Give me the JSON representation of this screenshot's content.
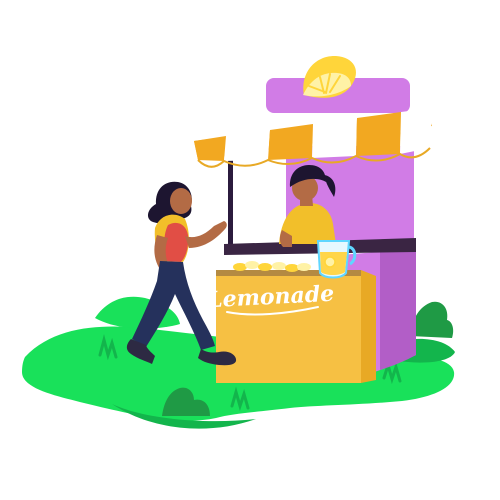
{
  "sign": {
    "text": "Lemonade"
  },
  "colors": {
    "grass": "#19e15a",
    "grass_dark": "#13b54c",
    "bush": "#1f9a45",
    "stall_purple": "#d17ce6",
    "stall_purple_dark": "#b25ec7",
    "stall_frame": "#2b1b3d",
    "awning_yellow": "#f2a821",
    "awning_white": "#ffffff",
    "counter_yellow": "#f6c043",
    "counter_top": "#3a2543",
    "lemon_yellow": "#ffd53a",
    "lemon_flesh": "#fff2a6",
    "skin": "#b36b45",
    "hair": "#1d1530",
    "shirt_yellow": "#f2bf2a",
    "shirt_red": "#e14e45",
    "pants": "#25315c",
    "shoe": "#2d2a43"
  },
  "icons": {
    "lemon": "lemon-icon",
    "pitcher": "pitcher-icon"
  }
}
